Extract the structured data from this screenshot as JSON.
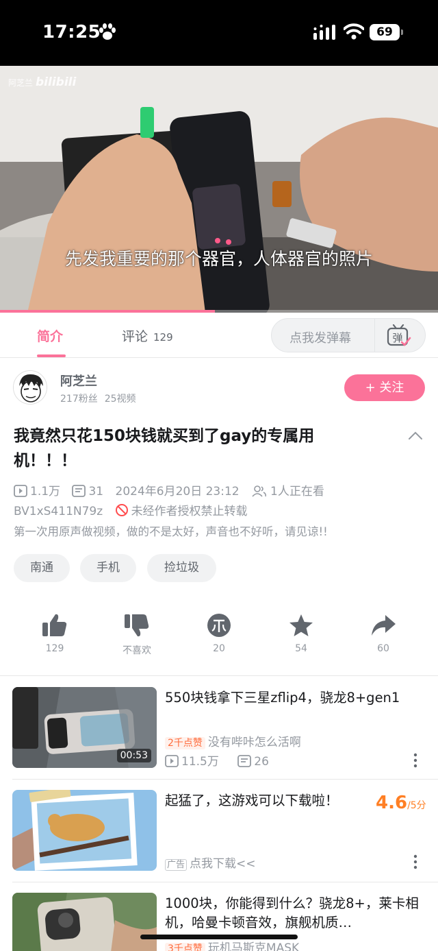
{
  "status_bar": {
    "time": "17:25",
    "battery": "69"
  },
  "video": {
    "watermark_user": "阿芝兰",
    "watermark_brand": "bilibili",
    "subtitle": "先发我重要的那个器官，人体器官的照片",
    "progress": 0.49
  },
  "tabs": {
    "intro": "简介",
    "comments": "评论",
    "comments_count": "129",
    "danmu_placeholder": "点我发弹幕",
    "danmu_icon_char": "弹"
  },
  "author": {
    "name": "阿芝兰",
    "fans": "217粉丝",
    "videos": "25视频",
    "follow_label": "+ 关注"
  },
  "video_info": {
    "title": "我竟然只花150块钱就买到了gay的专属用机！！！",
    "views": "1.1万",
    "danmaku": "31",
    "date": "2024年6月20日 23:12",
    "watching": "1人正在看",
    "bvid": "BV1xS411N79z",
    "copyright": "未经作者授权禁止转载",
    "description": "第一次用原声做视频，做的不是太好，声音也不好听，请见谅!!"
  },
  "tags": [
    "南通",
    "手机",
    "捡垃圾"
  ],
  "actions": {
    "like": "129",
    "dislike": "不喜欢",
    "coin": "20",
    "favorite": "54",
    "share": "60"
  },
  "recommendations": [
    {
      "title": "550块钱拿下三星zflip4，骁龙8+gen1",
      "badge": "2千点赞",
      "uploader": "没有哔咔怎么活啊",
      "views": "11.5万",
      "danmaku": "26",
      "duration": "00:53"
    },
    {
      "title": "起猛了，这游戏可以下载啦！",
      "ad_label": "广告",
      "cta": "点我下载<<",
      "rating_value": "4.6",
      "rating_suffix": "/5分"
    },
    {
      "title": "1000块，你能得到什么？骁龙8+，莱卡相机，哈曼卡顿音效，旗舰机质…",
      "badge": "3千点赞",
      "uploader": "玩机马斯克MASK"
    }
  ],
  "colors": {
    "accent": "#fb7299",
    "hot": "#ff6b3b",
    "rating": "#ff7f24",
    "muted": "#9499a0"
  }
}
